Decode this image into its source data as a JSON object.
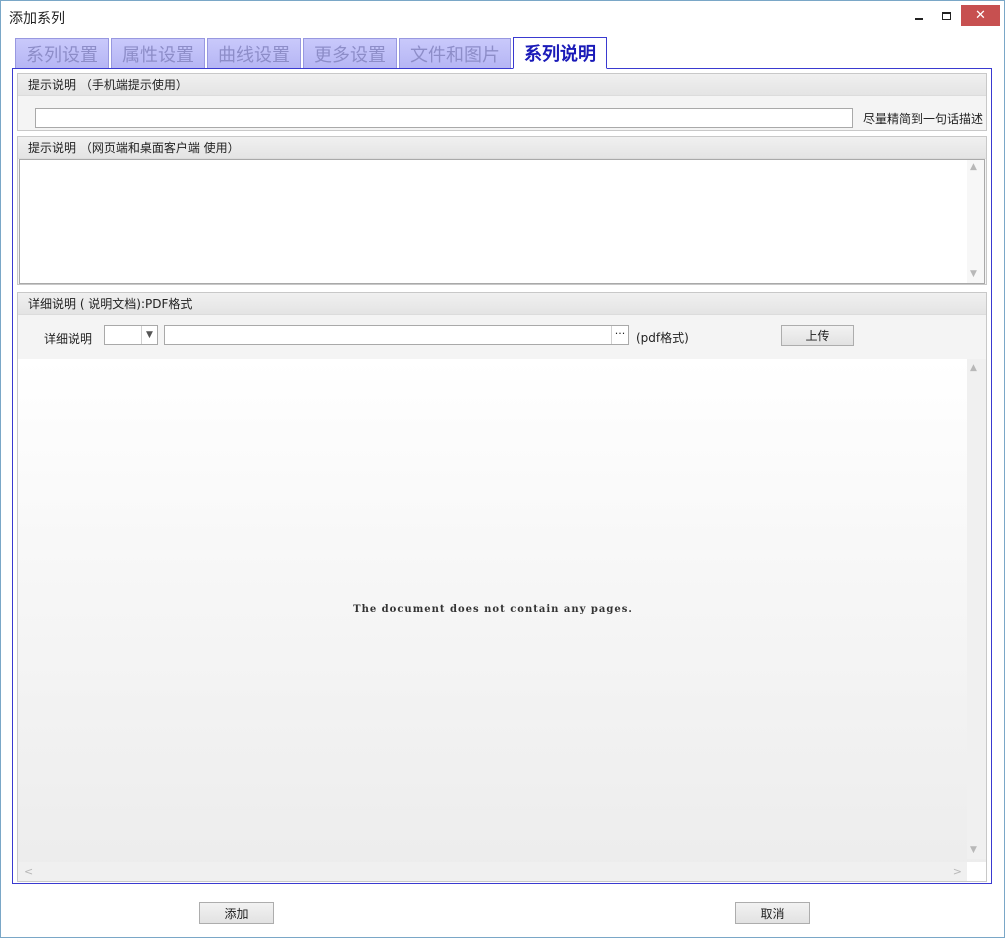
{
  "window": {
    "title": "添加系列",
    "minimize_glyph": "_",
    "close_glyph": "✕"
  },
  "tabs": [
    {
      "label": "系列设置",
      "active": false
    },
    {
      "label": "属性设置",
      "active": false
    },
    {
      "label": "曲线设置",
      "active": false
    },
    {
      "label": "更多设置",
      "active": false
    },
    {
      "label": "文件和图片",
      "active": false
    },
    {
      "label": "系列说明",
      "active": true
    }
  ],
  "mobile_hint": {
    "header": "提示说明  （手机端提示使用）",
    "value": "",
    "hint": "尽量精简到一句话描述"
  },
  "desktop_hint": {
    "header": "提示说明  （网页端和桌面客户端 使用）",
    "value": ""
  },
  "detail": {
    "header": "详细说明 ( 说明文档):PDF格式",
    "label": "详细说明",
    "select_value": "",
    "file_value": "",
    "browse_glyph": "···",
    "format_note": "(pdf格式)",
    "upload_label": "上传",
    "viewer_message": "The document does not contain any pages."
  },
  "footer": {
    "add_label": "添加",
    "cancel_label": "取消"
  },
  "icons": {
    "scroll_up": "▲",
    "scroll_down": "▼",
    "scroll_left": "<",
    "scroll_right": ">",
    "dropdown": "▼"
  },
  "colors": {
    "tab_inactive_bg": "#c0c0f8",
    "tab_active_text": "#1a1ab8",
    "close_button": "#c75050",
    "frame_border": "#3a3ad0"
  }
}
